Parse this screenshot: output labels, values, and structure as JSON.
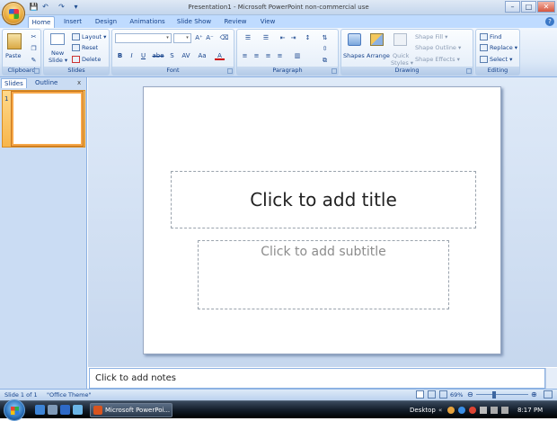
{
  "window": {
    "title": "Presentation1 - Microsoft PowerPoint non-commercial use",
    "min": "–",
    "max": "□",
    "close": "✕"
  },
  "qat": {
    "save": "💾",
    "undo": "↶",
    "redo": "↷",
    "more": "▾"
  },
  "tabs": [
    "Home",
    "Insert",
    "Design",
    "Animations",
    "Slide Show",
    "Review",
    "View"
  ],
  "ribbon": {
    "clipboard": {
      "label": "Clipboard",
      "paste": "Paste"
    },
    "slides": {
      "label": "Slides",
      "new_slide": "New",
      "new_slide_2": "Slide ▾",
      "layout": "Layout ▾",
      "reset": "Reset",
      "delete": "Delete"
    },
    "font": {
      "label": "Font",
      "font_name": "",
      "font_size": "",
      "bold": "B",
      "italic": "I",
      "underline": "U",
      "strike": "abe",
      "shadow": "S",
      "spacing": "AV",
      "case": "Aa",
      "color": "A",
      "grow": "A⁺",
      "shrink": "A⁻",
      "clear": "⌫"
    },
    "paragraph": {
      "label": "Paragraph"
    },
    "drawing": {
      "label": "Drawing",
      "shapes": "Shapes",
      "arrange": "Arrange",
      "quick": "Quick",
      "styles": "Styles ▾",
      "fill": "Shape Fill ▾",
      "outline": "Shape Outline ▾",
      "effects": "Shape Effects ▾"
    },
    "editing": {
      "label": "Editing",
      "find": "Find",
      "replace": "Replace ▾",
      "select": "Select ▾"
    }
  },
  "pane": {
    "tab_slides": "Slides",
    "tab_outline": "Outline",
    "close": "x",
    "slide_number": "1"
  },
  "slide": {
    "title_placeholder": "Click to add title",
    "subtitle_placeholder": "Click to add subtitle"
  },
  "notes": {
    "placeholder": "Click to add notes"
  },
  "status": {
    "slide": "Slide 1 of 1",
    "theme": "\"Office Theme\"",
    "zoom": "69%"
  },
  "taskbar": {
    "app": "Microsoft PowerPoi...",
    "desktop": "Desktop",
    "clock": "8:17 PM"
  }
}
